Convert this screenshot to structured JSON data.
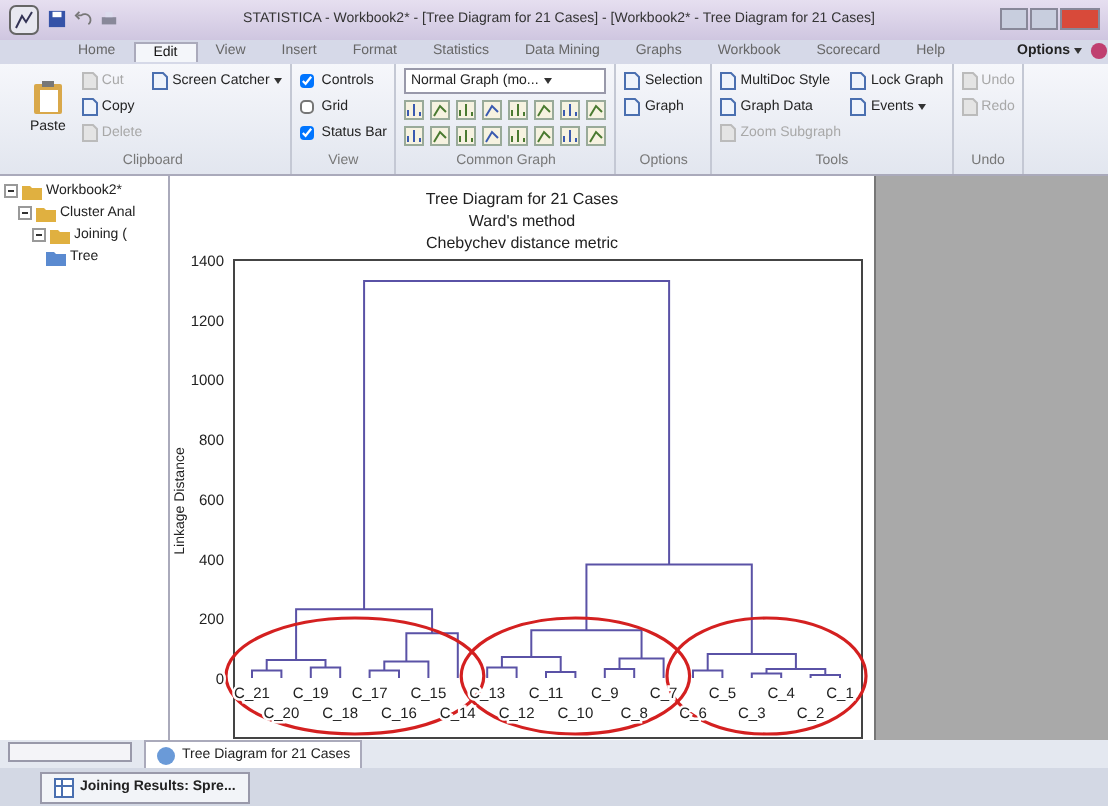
{
  "window": {
    "title": "STATISTICA - Workbook2* - [Tree Diagram for 21 Cases] - [Workbook2* - Tree Diagram for 21 Cases]"
  },
  "menu_tabs": [
    {
      "label": "Home",
      "selected": false
    },
    {
      "label": "Edit",
      "selected": true
    },
    {
      "label": "View",
      "selected": false
    },
    {
      "label": "Insert",
      "selected": false
    },
    {
      "label": "Format",
      "selected": false
    },
    {
      "label": "Statistics",
      "selected": false
    },
    {
      "label": "Data Mining",
      "selected": false
    },
    {
      "label": "Graphs",
      "selected": false
    },
    {
      "label": "Workbook",
      "selected": false
    },
    {
      "label": "Scorecard",
      "selected": false
    },
    {
      "label": "Help",
      "selected": false
    }
  ],
  "options_menu": {
    "label": "Options"
  },
  "ribbon_groups": [
    {
      "label": "Clipboard",
      "items": [
        {
          "kind": "large",
          "label": "Paste",
          "disabled": false,
          "menu": false
        },
        {
          "kind": "button",
          "label": "Cut",
          "disabled": true,
          "menu": false
        },
        {
          "kind": "button",
          "label": "Copy",
          "disabled": false,
          "menu": false
        },
        {
          "kind": "button",
          "label": "Delete",
          "disabled": true,
          "menu": false
        },
        {
          "kind": "button",
          "label": "Screen Catcher",
          "disabled": false,
          "menu": true
        }
      ]
    },
    {
      "label": "View",
      "items": [
        {
          "kind": "checkbox",
          "label": "Controls",
          "checked": true
        },
        {
          "kind": "checkbox",
          "label": "Grid",
          "checked": false
        },
        {
          "kind": "checkbox",
          "label": "Status Bar",
          "checked": true
        }
      ]
    },
    {
      "label": "Common Graph",
      "items": [
        {
          "kind": "dropdown",
          "label": "Normal Graph (mo..."
        },
        {
          "kind": "icon_row"
        },
        {
          "kind": "icon_row"
        }
      ]
    },
    {
      "label": "Options",
      "items": [
        {
          "kind": "button",
          "label": "Selection",
          "disabled": false,
          "menu": false
        },
        {
          "kind": "button",
          "label": "Graph",
          "disabled": false,
          "menu": false
        }
      ]
    },
    {
      "label": "Tools",
      "items": [
        {
          "kind": "button",
          "label": "MultiDoc Style",
          "disabled": false,
          "menu": false
        },
        {
          "kind": "button",
          "label": "Graph Data",
          "disabled": false,
          "menu": false
        },
        {
          "kind": "button",
          "label": "Zoom Subgraph",
          "disabled": true,
          "menu": false
        },
        {
          "kind": "button",
          "label": "Lock Graph",
          "disabled": false,
          "menu": false
        },
        {
          "kind": "button",
          "label": "Events",
          "disabled": false,
          "menu": true
        }
      ]
    },
    {
      "label": "Undo",
      "items": [
        {
          "kind": "button",
          "label": "Undo",
          "disabled": true,
          "menu": false
        },
        {
          "kind": "button",
          "label": "Redo",
          "disabled": true,
          "menu": false
        }
      ]
    }
  ],
  "tree": [
    {
      "label": "Workbook2*",
      "expanded": true,
      "children": [
        {
          "label": "Cluster Anal",
          "expanded": true,
          "children": [
            {
              "label": "Joining (",
              "expanded": true,
              "children": [
                {
                  "label": "Tree"
                }
              ]
            }
          ]
        }
      ]
    }
  ],
  "chart": {
    "title_lines": [
      "Tree Diagram for 21 Cases",
      "Ward's method",
      "Chebychev distance metric"
    ],
    "ylabel": "Linkage Distance",
    "yticks": [
      "1400",
      "1200",
      "1000",
      "800",
      "600",
      "400",
      "200",
      "0"
    ],
    "leaves": [
      "C_21",
      "C_20",
      "C_19",
      "C_18",
      "C_17",
      "C_16",
      "C_15",
      "C_14",
      "C_13",
      "C_12",
      "C_11",
      "C_10",
      "C_9",
      "C_8",
      "C_7",
      "C_6",
      "C_5",
      "C_3",
      "C_4",
      "C_2",
      "C_1"
    ]
  },
  "doc_tabs": [
    {
      "label": "Tree Diagram for 21 Cases",
      "selected": true
    }
  ],
  "window_tabs": [
    {
      "label": "Joining Results: Spre..."
    }
  ]
}
